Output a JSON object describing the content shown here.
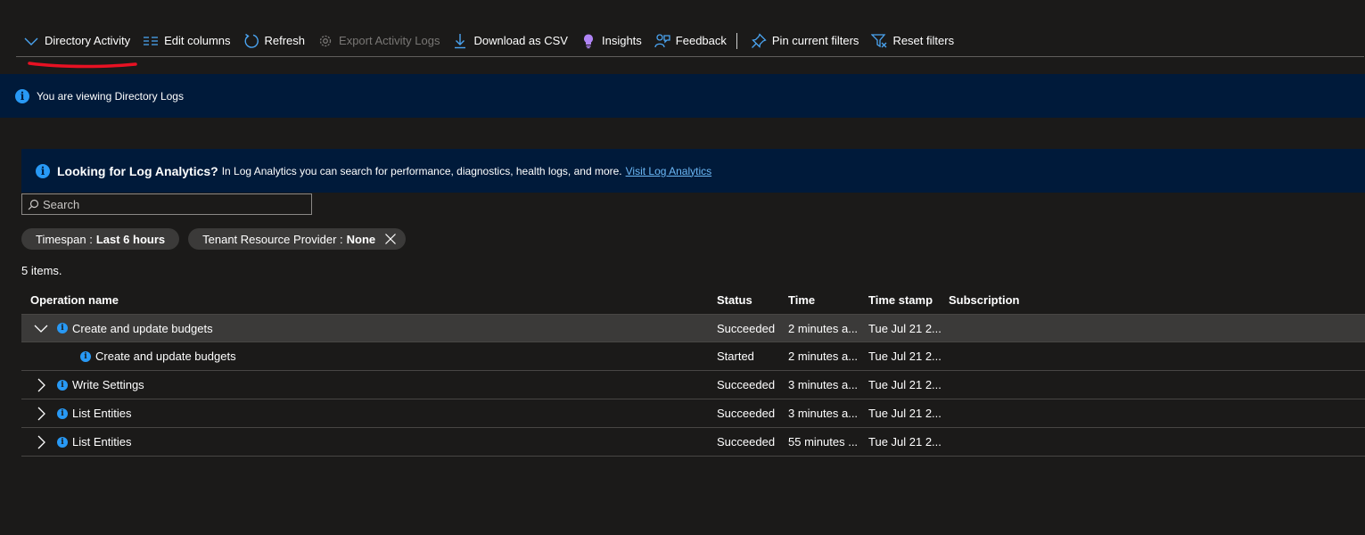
{
  "toolbar": {
    "directory_activity": "Directory Activity",
    "edit_columns": "Edit columns",
    "refresh": "Refresh",
    "export_activity_logs": "Export Activity Logs",
    "download_csv": "Download as CSV",
    "insights": "Insights",
    "feedback": "Feedback",
    "pin_filters": "Pin current filters",
    "reset_filters": "Reset filters"
  },
  "banner_directory": {
    "text": "You are viewing Directory Logs"
  },
  "banner_log_analytics": {
    "title": "Looking for Log Analytics?",
    "text": "In Log Analytics you can search for performance, diagnostics, health logs, and more.",
    "link": "Visit Log Analytics"
  },
  "search": {
    "placeholder": "Search"
  },
  "filters": {
    "timespan_label": "Timespan :",
    "timespan_value": "Last 6 hours",
    "provider_label": "Tenant Resource Provider :",
    "provider_value": "None"
  },
  "items_count": "5 items.",
  "table": {
    "headers": {
      "operation": "Operation name",
      "status": "Status",
      "time": "Time",
      "timestamp": "Time stamp",
      "subscription": "Subscription"
    },
    "rows": [
      {
        "name": "Create and update budgets",
        "status": "Succeeded",
        "time": "2 minutes a...",
        "timestamp": "Tue Jul 21 2...",
        "subscription": ""
      },
      {
        "name": "Create and update budgets",
        "status": "Started",
        "time": "2 minutes a...",
        "timestamp": "Tue Jul 21 2...",
        "subscription": ""
      },
      {
        "name": "Write Settings",
        "status": "Succeeded",
        "time": "3 minutes a...",
        "timestamp": "Tue Jul 21 2...",
        "subscription": ""
      },
      {
        "name": "List Entities",
        "status": "Succeeded",
        "time": "3 minutes a...",
        "timestamp": "Tue Jul 21 2...",
        "subscription": ""
      },
      {
        "name": "List Entities",
        "status": "Succeeded",
        "time": "55 minutes ...",
        "timestamp": "Tue Jul 21 2...",
        "subscription": ""
      }
    ]
  },
  "colors": {
    "background": "#1b1a19",
    "banner": "#001a3a",
    "accent": "#2899f5",
    "annotation": "#e81123"
  }
}
